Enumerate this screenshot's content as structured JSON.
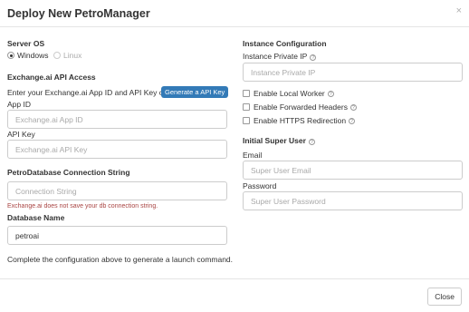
{
  "modal": {
    "title": "Deploy New PetroManager",
    "close_glyph": "×"
  },
  "left": {
    "server_os": {
      "heading": "Server OS",
      "options": [
        "Windows",
        "Linux"
      ],
      "selected": "Windows"
    },
    "api_access": {
      "heading": "Exchange.ai API Access",
      "instructions": "Enter your Exchange.ai App ID and API Key or",
      "generate_button": "Generate a API Key",
      "app_id_label": "App ID",
      "app_id_placeholder": "Exchange.ai App ID",
      "api_key_label": "API Key",
      "api_key_placeholder": "Exchange.ai API Key"
    },
    "connection": {
      "heading": "PetroDatabase Connection String",
      "placeholder": "Connection String",
      "warning": "Exchange.ai does not save your db connection string."
    },
    "database": {
      "heading": "Database Name",
      "value": "petroai"
    },
    "footer_note": "Complete the configuration above to generate a launch command."
  },
  "right": {
    "instance": {
      "heading": "Instance Configuration",
      "private_ip_label": "Instance Private IP",
      "private_ip_placeholder": "Instance Private IP",
      "options": [
        {
          "label": "Enable Local Worker",
          "checked": false
        },
        {
          "label": "Enable Forwarded Headers",
          "checked": false
        },
        {
          "label": "Enable HTTPS Redirection",
          "checked": false
        }
      ]
    },
    "super_user": {
      "heading": "Initial Super User",
      "email_label": "Email",
      "email_placeholder": "Super User Email",
      "password_label": "Password",
      "password_placeholder": "Super User Password"
    }
  },
  "footer": {
    "close_label": "Close"
  },
  "icons": {
    "help": "help-circle-icon",
    "close": "close-icon"
  }
}
